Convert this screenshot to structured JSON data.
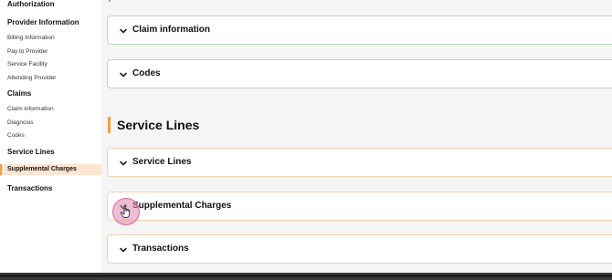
{
  "sidebar": {
    "headings": {
      "authorization": "Authorization",
      "provider_information": "Provider Information",
      "claims": "Claims",
      "service_lines": "Service Lines",
      "transactions": "Transactions"
    },
    "provider_items": [
      "Billing Information",
      "Pay to Provider",
      "Service Facility",
      "Attending Provider"
    ],
    "claims_items": [
      "Claim information",
      "Diagnosis",
      "Codes"
    ],
    "active_item": "Supplemental Charges"
  },
  "main": {
    "claims_cards": [
      "Claim information",
      "Codes"
    ],
    "section_title": "Service Lines",
    "service_cards": [
      "Service Lines",
      "Supplemental Charges",
      "Transactions"
    ]
  },
  "colors": {
    "accent": "#f39c3f",
    "active_bg": "#fde6d2",
    "green_border": "#b9dcb9",
    "orange_border": "#f6d2ad"
  },
  "icons": {
    "card_toggle": "chevron-down-icon",
    "cursor": "hand-pointer-icon"
  }
}
